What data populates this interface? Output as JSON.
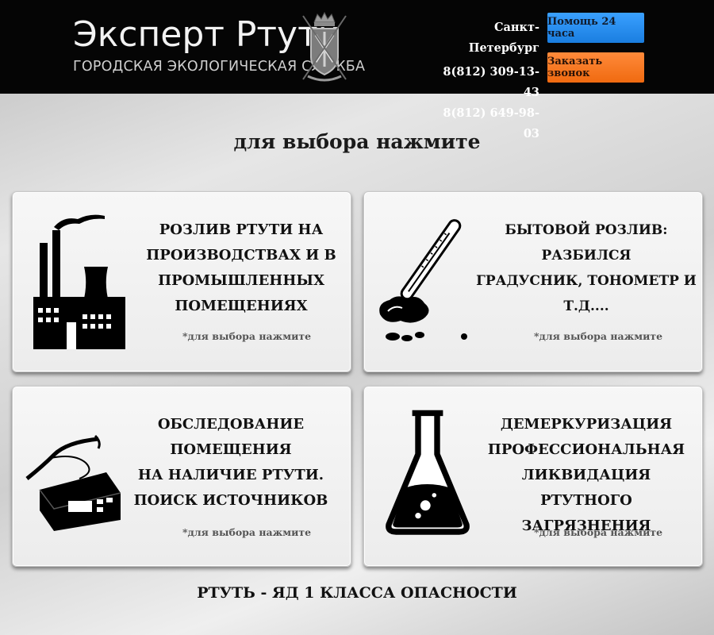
{
  "header": {
    "title": "Эксперт Ртути",
    "subtitle": "ГОРОДСКАЯ ЭКОЛОГИЧЕСКАЯ СЛУЖБА",
    "crest_icon": "city-crest-icon",
    "city": "Санкт-Петербург",
    "phone1": "8(812) 309-13-43",
    "phone2": "8(812) 649-98-03",
    "help_button": "Помощь 24 часа",
    "call_button": "Заказать звонок"
  },
  "main": {
    "prompt": "для выбора нажмите",
    "cards": [
      {
        "title_lines": [
          "РОЗЛИВ РТУТИ НА",
          "ПРОИЗВОДСТВАХ И В",
          "ПРОМЫШЛЕННЫХ",
          "ПОМЕЩЕНИЯХ"
        ],
        "hint": "*для выбора нажмите",
        "icon": "factory-icon"
      },
      {
        "title_lines": [
          "БЫТОВОЙ РОЗЛИВ: РАЗБИЛСЯ",
          "ГРАДУСНИК, ТОНОМЕТР И Т.Д...."
        ],
        "hint": "*для выбора нажмите",
        "icon": "broken-thermometer-icon"
      },
      {
        "title_lines": [
          "ОБСЛЕДОВАНИЕ ПОМЕЩЕНИЯ",
          "НА НАЛИЧИЕ РТУТИ.",
          "ПОИСК ИСТОЧНИКОВ"
        ],
        "hint": "*для выбора нажмите",
        "icon": "mercury-analyzer-icon"
      },
      {
        "title_lines": [
          "ДЕМЕРКУРИЗАЦИЯ",
          "ПРОФЕССИОНАЛЬНАЯ",
          "ЛИКВИДАЦИЯ РТУТНОГО",
          "ЗАГРЯЗНЕНИЯ"
        ],
        "hint": "*для выбора нажмите",
        "icon": "flask-icon"
      }
    ]
  },
  "footer": {
    "warning": "РТУТЬ - ЯД 1 КЛАССА ОПАСНОСТИ"
  }
}
